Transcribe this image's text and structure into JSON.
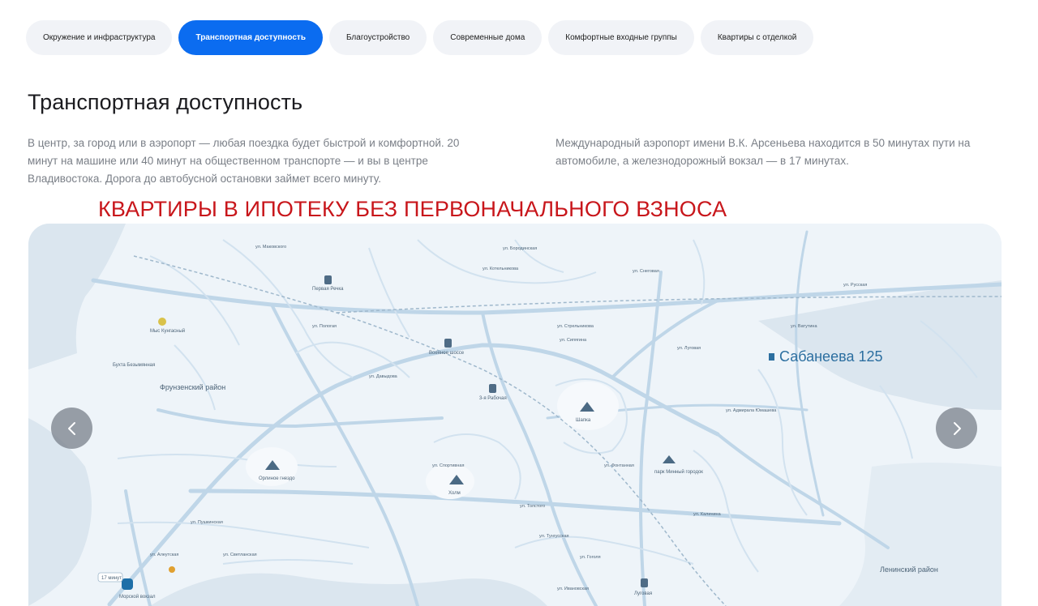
{
  "tabs": [
    {
      "label": "Окружение и инфраструктура",
      "active": false
    },
    {
      "label": "Транспортная доступность",
      "active": true
    },
    {
      "label": "Благоустройство",
      "active": false
    },
    {
      "label": "Современные дома",
      "active": false
    },
    {
      "label": "Комфортные входные группы",
      "active": false
    },
    {
      "label": "Квартиры с отделкой",
      "active": false
    }
  ],
  "section": {
    "title": "Транспортная доступность",
    "paragraph_left": "В центр, за город или в аэропорт — любая поездка будет быстрой и комфортной. 20 минут на машине или 40 минут на общественном транспорте — и вы в центре Владивостока. Дорога до автобусной остановки займет всего минуту.",
    "paragraph_right": "Международный аэропорт имени В.К. Арсеньева находится в 50 минутах пути на автомобиле, а железнодорожный вокзал — в 17 минутах."
  },
  "promo_banner": "КВАРТИРЫ В ИПОТЕКУ БЕЗ ПЕРВОНАЧАЛЬНОГО ВЗНОСА",
  "map": {
    "project_marker": "Сабанеева 125",
    "districts": [
      "Фрунзенский район",
      "Ленинский район"
    ],
    "places": {
      "vtoraya_rechka": "Первая Речка",
      "voennoe_shosse": "Военное шоссе",
      "tretya_rabochaya": "3-я Рабочая",
      "lugovaya": "Луговая",
      "morskoy_vokzal": "Морской вокзал",
      "mys_kungasny": "Мыс Кунгасный",
      "bukhta": "Бухта Безымянная",
      "orlinoe_gnezdo": "Орлиное гнездо",
      "kholm": "Холм",
      "sopka": "Шапка",
      "park": "парк Минный городок",
      "chip": "17 минут"
    },
    "streets": [
      "ул. Светланская",
      "ул. Русская",
      "ул. Снеговая",
      "ул. Бородинская",
      "ул. Котельникова",
      "ул. Стрельникова",
      "ул. Адмирала Юмашева",
      "ул. Тунгусская",
      "ул. Гоголя",
      "ул. Ивановская",
      "ул. Спортивная",
      "ул. Калинина",
      "ул. Фонтанная",
      "ул. Сипягина",
      "ул. Луговая",
      "ул. Маковского",
      "ул. Ватутина",
      "ул. Толстого",
      "ул. Давыдова",
      "ул. Пушкинская",
      "ул. Алеутская",
      "ул. Пологая"
    ],
    "colors": {
      "water": "#dbe6ef",
      "land": "#eef4f9",
      "roads": "#b9d2e6",
      "accent": "#1e6fa8",
      "text": "#4d6478"
    }
  },
  "carousel": {
    "prev_icon": "chevron-left-icon",
    "next_icon": "chevron-right-icon"
  }
}
